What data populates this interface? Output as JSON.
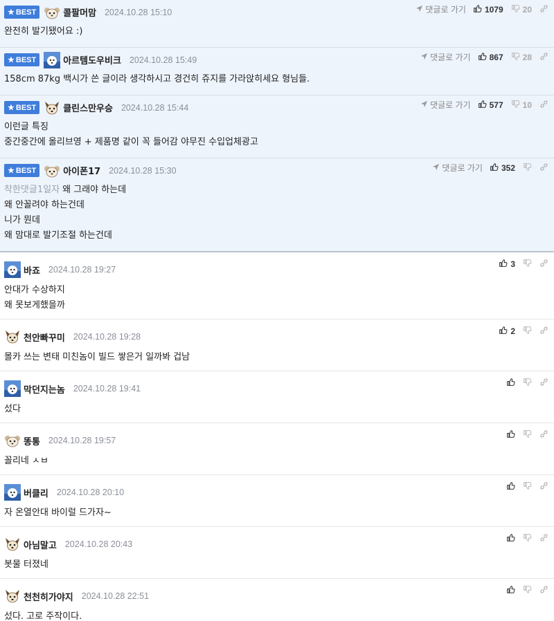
{
  "labels": {
    "best_badge": "BEST",
    "goto_parent": "댓글로 가기"
  },
  "best_comments": [
    {
      "nick": "콜팔머맘",
      "date": "2024.10.28 15:10",
      "avatar": "mouse-avatar",
      "up": "1079",
      "down": "20",
      "lines": [
        "완전히 발기됐어요 :)"
      ]
    },
    {
      "nick": "아르템도우비크",
      "date": "2024.10.28 15:49",
      "avatar": "blue-avatar",
      "up": "867",
      "down": "28",
      "lines": [
        "158cm 87kg 백시가 쓴 글이라 생각하시고 경건히 쥬지를 가라앉히세요 형님들."
      ]
    },
    {
      "nick": "클린스만우승",
      "date": "2024.10.28 15:44",
      "avatar": "dog-avatar",
      "up": "577",
      "down": "10",
      "lines": [
        "이런글 특징",
        "중간중간에 올리브영 + 제품명 같이 꼭 들어감 야무진 수입업체광고"
      ]
    },
    {
      "nick": "아이폰17",
      "date": "2024.10.28 15:30",
      "avatar": "mouse-avatar",
      "up": "352",
      "down": "",
      "mention": "착한댓글1일자",
      "lines": [
        "왜 그래야 하는데",
        "왜 안꼴려야 하는건데",
        "니가 뭔데",
        "왜 맘대로 발기조절 하는건데"
      ]
    }
  ],
  "comments": [
    {
      "nick": "바죠",
      "date": "2024.10.28 19:27",
      "avatar": "blue-avatar",
      "up": "3",
      "lines": [
        "안대가 수상하지",
        "왜 못보게했을까"
      ]
    },
    {
      "nick": "천안빠꾸미",
      "date": "2024.10.28 19:28",
      "avatar": "dog-avatar",
      "up": "2",
      "lines": [
        "몰카 쓰는 변태 미친놈이 빌드 쌓은거 일까봐 겁남"
      ]
    },
    {
      "nick": "막던지는놈",
      "date": "2024.10.28 19:41",
      "avatar": "blue-avatar",
      "up": "",
      "lines": [
        "섰다"
      ]
    },
    {
      "nick": "똥통",
      "date": "2024.10.28 19:57",
      "avatar": "mouse-avatar",
      "up": "",
      "lines": [
        "꼴리네 ㅅㅂ"
      ]
    },
    {
      "nick": "버클리",
      "date": "2024.10.28 20:10",
      "avatar": "blue-avatar",
      "up": "",
      "lines": [
        "자 온열안대 바이럴 드가자~"
      ]
    },
    {
      "nick": "아님말고",
      "date": "2024.10.28 20:43",
      "avatar": "dog-avatar",
      "up": "",
      "lines": [
        "봇물 터졌네"
      ]
    },
    {
      "nick": "천천히가야지",
      "date": "2024.10.28 22:51",
      "avatar": "dog-avatar",
      "up": "",
      "lines": [
        "섰다. 고로 주작이다."
      ]
    }
  ],
  "colors": {
    "best_bg": "#eef4fc",
    "badge": "#3f7ddb",
    "date": "#8a8f98",
    "mention": "#9aa3ad"
  }
}
